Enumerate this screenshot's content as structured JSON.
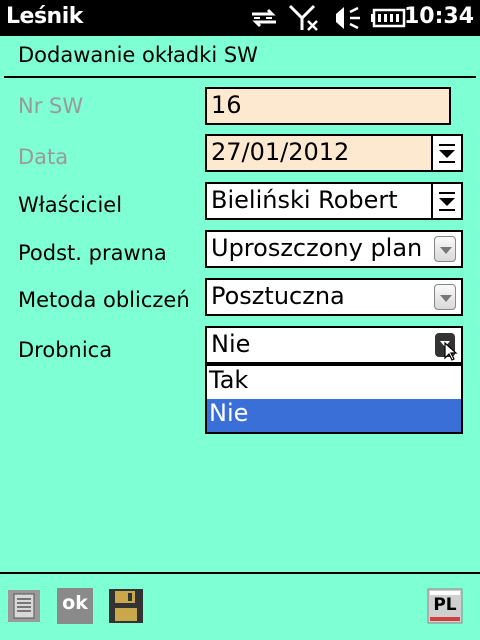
{
  "status_bar": {
    "app_name": "Leśnik",
    "time": "10:34",
    "icons": [
      "sync-icon",
      "no-signal-icon",
      "volume-muted-icon",
      "battery-icon"
    ]
  },
  "form": {
    "title": "Dodawanie okładki SW",
    "fields": [
      {
        "label": "Nr SW",
        "value": "16"
      },
      {
        "label": "Data",
        "value": "27/01/2012"
      },
      {
        "label": "Właściciel",
        "value": "Bieliński Robert"
      },
      {
        "label": "Podst. prawna",
        "value": "Uproszczony plan u"
      },
      {
        "label": "Metoda obliczeń",
        "value": "Posztuczna"
      },
      {
        "label": "Drobnica",
        "value": "Nie"
      }
    ],
    "drobnica_options": [
      "Tak",
      "Nie"
    ],
    "drobnica_selected": "Nie"
  },
  "toolbar": {
    "ok_label": "ok",
    "lang_label": "PL",
    "icons": [
      "list-icon",
      "ok-icon",
      "save-icon",
      "language-icon"
    ]
  },
  "colors": {
    "background": "#7fffd4",
    "readonly_field": "#fde8d0",
    "selection": "#3b6fd8"
  }
}
